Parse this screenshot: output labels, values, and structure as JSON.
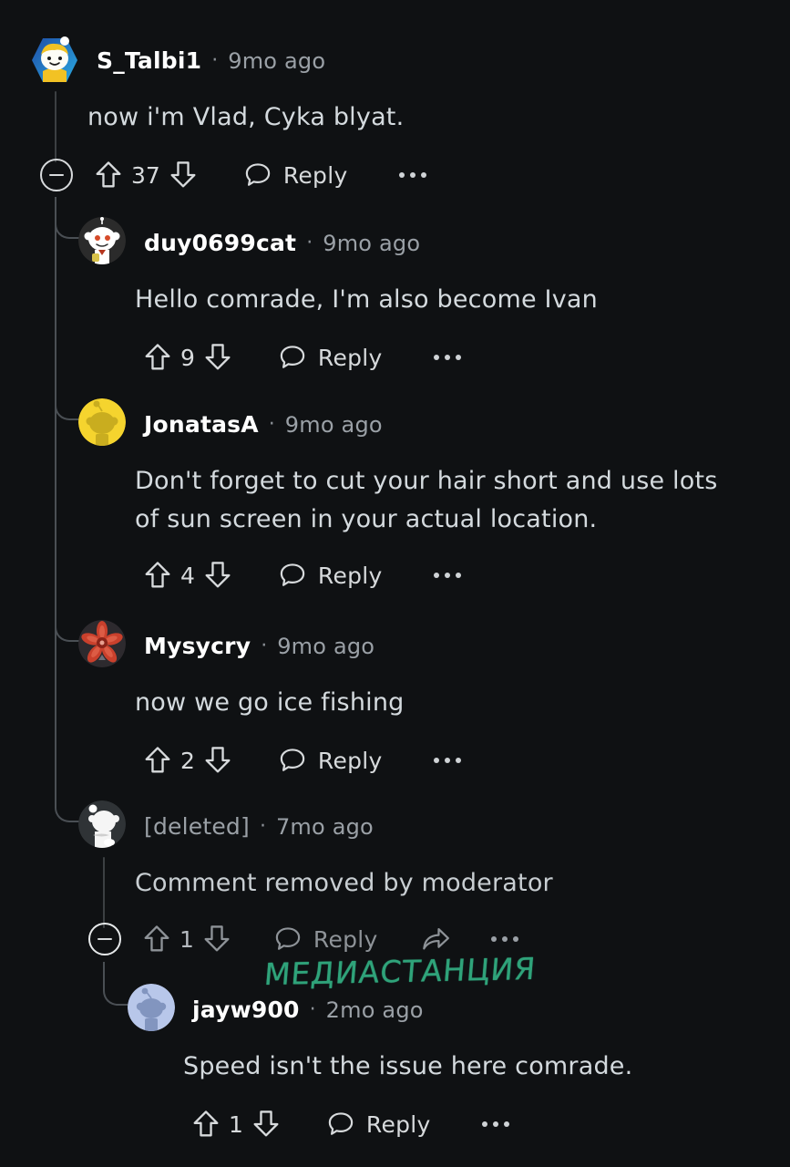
{
  "theme": {
    "background": "#0f1113",
    "text_primary": "#d4dade",
    "username": "#ffffff",
    "muted": "#9aa0a6",
    "threadline": "#3c4043",
    "watermark_color": "#2fa37a"
  },
  "watermark": {
    "text": "МЕДИАСТАНЦИЯ"
  },
  "labels": {
    "reply": "Reply",
    "separator": "·"
  },
  "icons": {
    "collapse": "minus-circle-icon",
    "upvote": "upvote-arrow-icon",
    "downvote": "downvote-arrow-icon",
    "reply": "speech-bubble-icon",
    "share": "share-arrow-icon",
    "more": "more-options-icon"
  },
  "comments": [
    {
      "id": "c1",
      "depth": 0,
      "username": "S_Talbi1",
      "timestamp": "9mo ago",
      "body": "now i'm Vlad, Cyka blyat.",
      "score": "37",
      "reply_label": "Reply",
      "has_collapse": true,
      "has_share": false,
      "deleted": false,
      "avatar": "nft-hex-blonde-avatar"
    },
    {
      "id": "c2",
      "depth": 1,
      "username": "duy0699cat",
      "timestamp": "9mo ago",
      "body": "Hello comrade, I'm also become Ivan",
      "score": "9",
      "reply_label": "Reply",
      "has_collapse": false,
      "has_share": false,
      "deleted": false,
      "avatar": "snoo-white-avatar"
    },
    {
      "id": "c3",
      "depth": 1,
      "username": "JonatasA",
      "timestamp": "9mo ago",
      "body": "Don't forget to cut your hair short and use lots of sun screen in your actual location.",
      "score": "4",
      "reply_label": "Reply",
      "has_collapse": false,
      "has_share": false,
      "deleted": false,
      "avatar": "snoo-yellow-avatar"
    },
    {
      "id": "c4",
      "depth": 1,
      "username": "Mysycry",
      "timestamp": "9mo ago",
      "body": "now we go ice fishing",
      "score": "2",
      "reply_label": "Reply",
      "has_collapse": false,
      "has_share": false,
      "deleted": false,
      "avatar": "red-flower-avatar"
    },
    {
      "id": "c5",
      "depth": 1,
      "username": "[deleted]",
      "timestamp": "7mo ago",
      "body": "Comment removed by moderator",
      "score": "1",
      "reply_label": "Reply",
      "has_collapse": true,
      "has_share": true,
      "deleted": true,
      "avatar": "snoo-deleted-avatar"
    },
    {
      "id": "c6",
      "depth": 2,
      "username": "jayw900",
      "timestamp": "2mo ago",
      "body": "Speed isn't the issue here comrade.",
      "score": "1",
      "reply_label": "Reply",
      "has_collapse": false,
      "has_share": false,
      "deleted": false,
      "avatar": "snoo-blue-avatar"
    }
  ]
}
